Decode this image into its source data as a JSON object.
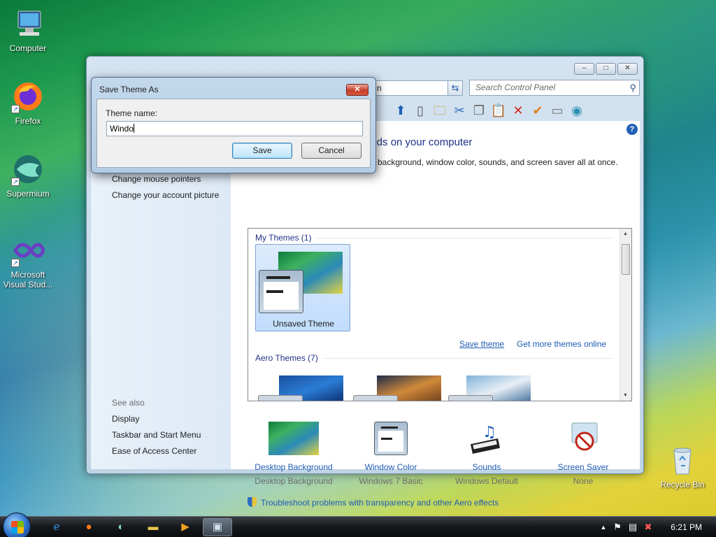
{
  "desktop": {
    "icons": [
      {
        "label": "Computer"
      },
      {
        "label": "Firefox"
      },
      {
        "label": "Supermium"
      },
      {
        "label_line1": "Microsoft",
        "label_line2": "Visual Stud..."
      },
      {
        "label": "Recycle Bin"
      }
    ]
  },
  "window": {
    "address_text": "n",
    "search_placeholder": "Search Control Panel",
    "heading": "unds on your computer",
    "description": "p background, window color, sounds, and screen saver all at once.",
    "left_links": [
      "Change mouse pointers",
      "Change your account picture"
    ],
    "see_also_label": "See also",
    "see_also_links": [
      "Display",
      "Taskbar and Start Menu",
      "Ease of Access Center"
    ],
    "themes": {
      "my_themes_header": "My Themes (1)",
      "unsaved_label": "Unsaved Theme",
      "save_theme_link": "Save theme",
      "more_themes_link": "Get more themes online",
      "aero_header": "Aero Themes (7)"
    },
    "bottom_items": [
      {
        "title": "Desktop Background",
        "subtitle": "Desktop Background"
      },
      {
        "title": "Window Color",
        "subtitle": "Windows 7 Basic"
      },
      {
        "title": "Sounds",
        "subtitle": "Windows Default"
      },
      {
        "title": "Screen Saver",
        "subtitle": "None"
      }
    ],
    "troubleshoot_link": "Troubleshoot problems with transparency and other Aero effects"
  },
  "dialog": {
    "title": "Save Theme As",
    "field_label": "Theme name:",
    "field_value": "Windo",
    "save_label": "Save",
    "cancel_label": "Cancel"
  },
  "taskbar": {
    "clock": "6:21 PM"
  },
  "colors": {
    "link": "#1e5cb3",
    "heading": "#1e3287"
  }
}
